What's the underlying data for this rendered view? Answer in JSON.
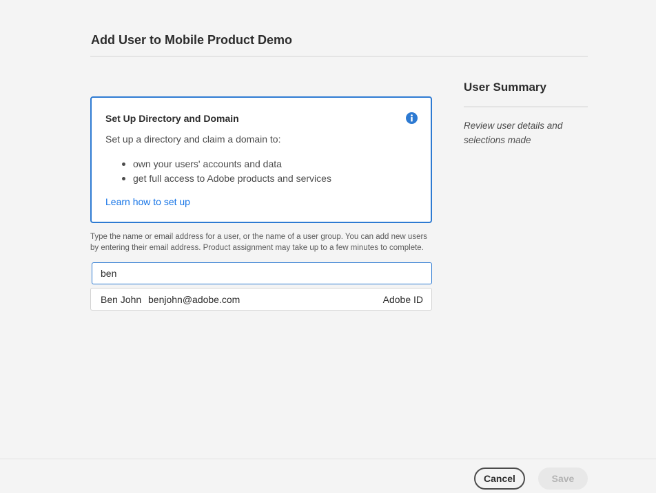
{
  "dialog": {
    "title": "Add User to Mobile Product Demo"
  },
  "info_card": {
    "title": "Set Up Directory and Domain",
    "description": "Set up a directory and claim a domain to:",
    "bullets": [
      "own your users' accounts and data",
      "get full access to Adobe products and services"
    ],
    "link_label": "Learn how to set up",
    "icon": "info-icon",
    "accent_color": "#2d7ad2"
  },
  "helper_text": "Type the name or email address for a user, or the name of a user group. You can add new users by entering their email address. Product assignment may take up to a few minutes to complete.",
  "search": {
    "value": "ben"
  },
  "results": [
    {
      "name": "Ben John",
      "email": "benjohn@adobe.com",
      "type": "Adobe ID"
    }
  ],
  "summary": {
    "title": "User Summary",
    "text": "Review user details and selections made"
  },
  "footer": {
    "cancel_label": "Cancel",
    "save_label": "Save"
  }
}
